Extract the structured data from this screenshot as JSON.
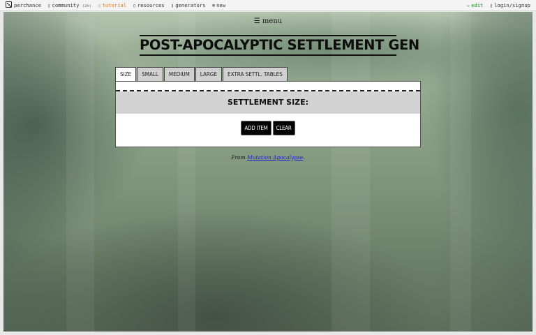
{
  "topbar": {
    "brand": "perchance",
    "community": "community",
    "community_count": "(2h)",
    "tutorial": "tutorial",
    "resources": "resources",
    "generators": "generators",
    "new": "new",
    "edit": "edit",
    "login": "login/signup",
    "icons": {
      "brand": "dice-icon",
      "community": "chat-icon",
      "tutorial": "book-icon",
      "resources": "folder-icon",
      "generators": "gear-icon",
      "new": "plus-circle-icon",
      "edit": "pencil-icon",
      "login": "user-icon"
    }
  },
  "menu": "☰ menu",
  "title": "POST-APOCALYPTIC SETTLEMENT GEN",
  "tabs": [
    "SIZE",
    "SMALL",
    "MEDIUM",
    "LARGE",
    "EXTRA SETTL. TABLES"
  ],
  "active_tab": "SIZE",
  "panel": {
    "heading": "SETTLEMENT SIZE:",
    "add_button": "ADD ITEM",
    "clear_button": "CLEAR"
  },
  "credit": {
    "prefix": "From ",
    "link_text": "Mutation Apocalypse",
    "suffix": "."
  },
  "colors": {
    "tutorial": "#d87a1a",
    "edit": "#2a8a2a",
    "link": "#1a1ad8",
    "button_bg": "#000000",
    "header_bg": "#d3d3d3"
  }
}
